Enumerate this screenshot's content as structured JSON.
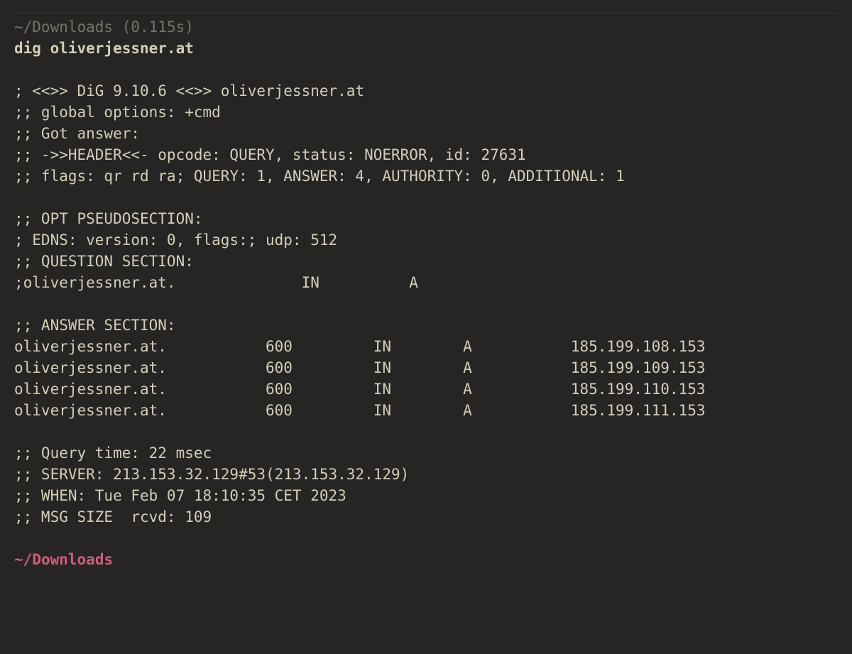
{
  "prompt": {
    "path": "~/Downloads",
    "timing": "(0.115s)"
  },
  "command": "dig oliverjessner.at",
  "output": {
    "blank0": "",
    "banner": "; <<>> DiG 9.10.6 <<>> oliverjessner.at",
    "global_options": ";; global options: +cmd",
    "got_answer": ";; Got answer:",
    "header": ";; ->>HEADER<<- opcode: QUERY, status: NOERROR, id: 27631",
    "flags": ";; flags: qr rd ra; QUERY: 1, ANSWER: 4, AUTHORITY: 0, ADDITIONAL: 1",
    "blank1": "",
    "opt_title": ";; OPT PSEUDOSECTION:",
    "edns": "; EDNS: version: 0, flags:; udp: 512",
    "question_title": ";; QUESTION SECTION:",
    "question": {
      "name": ";oliverjessner.at.",
      "class": "IN",
      "type": "A"
    },
    "blank2": "",
    "answer_title": ";; ANSWER SECTION:",
    "answers": [
      {
        "name": "oliverjessner.at.",
        "ttl": "600",
        "class": "IN",
        "type": "A",
        "data": "185.199.108.153"
      },
      {
        "name": "oliverjessner.at.",
        "ttl": "600",
        "class": "IN",
        "type": "A",
        "data": "185.199.109.153"
      },
      {
        "name": "oliverjessner.at.",
        "ttl": "600",
        "class": "IN",
        "type": "A",
        "data": "185.199.110.153"
      },
      {
        "name": "oliverjessner.at.",
        "ttl": "600",
        "class": "IN",
        "type": "A",
        "data": "185.199.111.153"
      }
    ],
    "blank3": "",
    "query_time": ";; Query time: 22 msec",
    "server": ";; SERVER: 213.153.32.129#53(213.153.32.129)",
    "when": ";; WHEN: Tue Feb 07 18:10:35 CET 2023",
    "msg_size": ";; MSG SIZE  rcvd: 109",
    "blank4": ""
  },
  "prompt2": {
    "tilde": "~",
    "sep": "/",
    "dir": "Downloads"
  }
}
